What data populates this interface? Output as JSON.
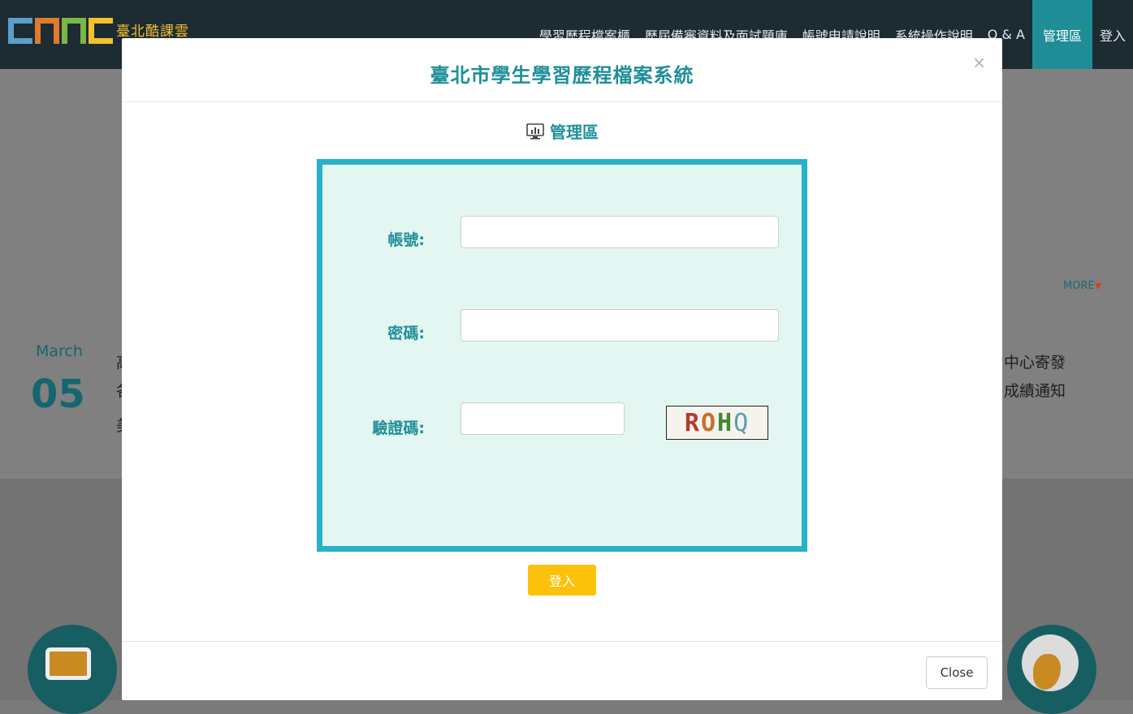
{
  "site": {
    "brand": "臺北酷課雲",
    "nav": [
      "學習歷程檔案櫃",
      "歷屆備審資料及面試題庫",
      "帳號申請說明",
      "系統操作說明",
      "Q & A",
      "管理區",
      "登入"
    ],
    "active_nav": "管理區"
  },
  "background": {
    "more_label": "MORE",
    "date_month": "March",
    "date_day": "05",
    "right_text_line1": "中心寄發",
    "right_text_line2": "成績通知",
    "left_text_line1": "高",
    "left_text_line2": "各",
    "left_text_line3": "美"
  },
  "modal": {
    "title": "臺北市學生學習歷程檔案系統",
    "close_symbol": "×",
    "section_title": "管理區",
    "fields": {
      "account_label": "帳號:",
      "account_value": "",
      "password_label": "密碼:",
      "password_value": "",
      "captcha_label": "驗證碼:",
      "captcha_value": ""
    },
    "captcha_chars": [
      "R",
      "O",
      "H",
      "Q"
    ],
    "login_label": "登入",
    "close_label": "Close"
  },
  "colors": {
    "accent": "#1f8f99",
    "panel_border": "#28b1c8",
    "panel_bg": "#e3f6f1",
    "login_button": "#fcc10a",
    "navbar": "#1d2b33"
  },
  "icons": {
    "section": "monitor-chart-icon",
    "more": "chevron-down-icon"
  }
}
